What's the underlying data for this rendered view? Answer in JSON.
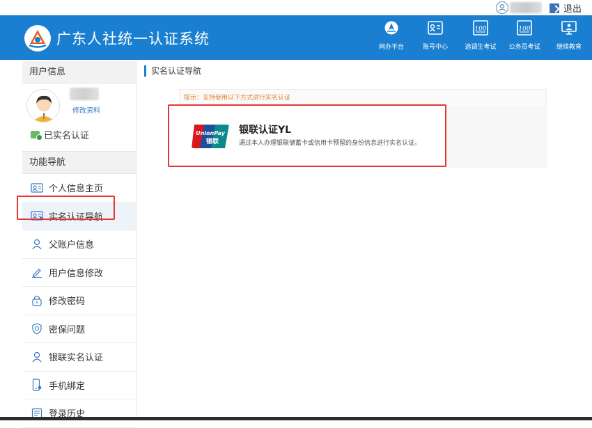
{
  "topbar": {
    "logout_label": "退出"
  },
  "header": {
    "title": "广东人社统一认证系统",
    "nav": [
      {
        "label": "网办平台",
        "icon": "compass-icon"
      },
      {
        "label": "账号中心",
        "icon": "id-card-icon"
      },
      {
        "label": "选调生考试",
        "icon": "exam-100-icon"
      },
      {
        "label": "公务员考试",
        "icon": "exam-100-icon"
      },
      {
        "label": "继续教育",
        "icon": "monitor-teacher-icon"
      }
    ]
  },
  "sidebar": {
    "user_info_title": "用户信息",
    "edit_profile": "修改资料",
    "verified_status": "已实名认证",
    "nav_title": "功能导航",
    "items": [
      {
        "label": "个人信息主页",
        "icon": "profile-card-icon"
      },
      {
        "label": "实名认证导航",
        "icon": "id-card-icon"
      },
      {
        "label": "父账户信息",
        "icon": "person-icon"
      },
      {
        "label": "用户信息修改",
        "icon": "pencil-icon"
      },
      {
        "label": "修改密码",
        "icon": "lock-icon"
      },
      {
        "label": "密保问题",
        "icon": "shield-icon"
      },
      {
        "label": "银联实名认证",
        "icon": "person-icon"
      },
      {
        "label": "手机绑定",
        "icon": "phone-icon"
      },
      {
        "label": "登录历史",
        "icon": "history-icon"
      }
    ]
  },
  "main": {
    "breadcrumb": "实名认证导航",
    "tip": "提示：支持使用以下方式进行实名认证",
    "card": {
      "logo_text": "UnionPay",
      "logo_subtext": "银联",
      "title": "银联认证YL",
      "desc": "通过本人办理银联储蓄卡或信用卡预留的身份信息进行实名认证。"
    }
  },
  "colors": {
    "header": "#1a7fd0",
    "highlight": "#e53535",
    "tip": "#e0822c"
  }
}
